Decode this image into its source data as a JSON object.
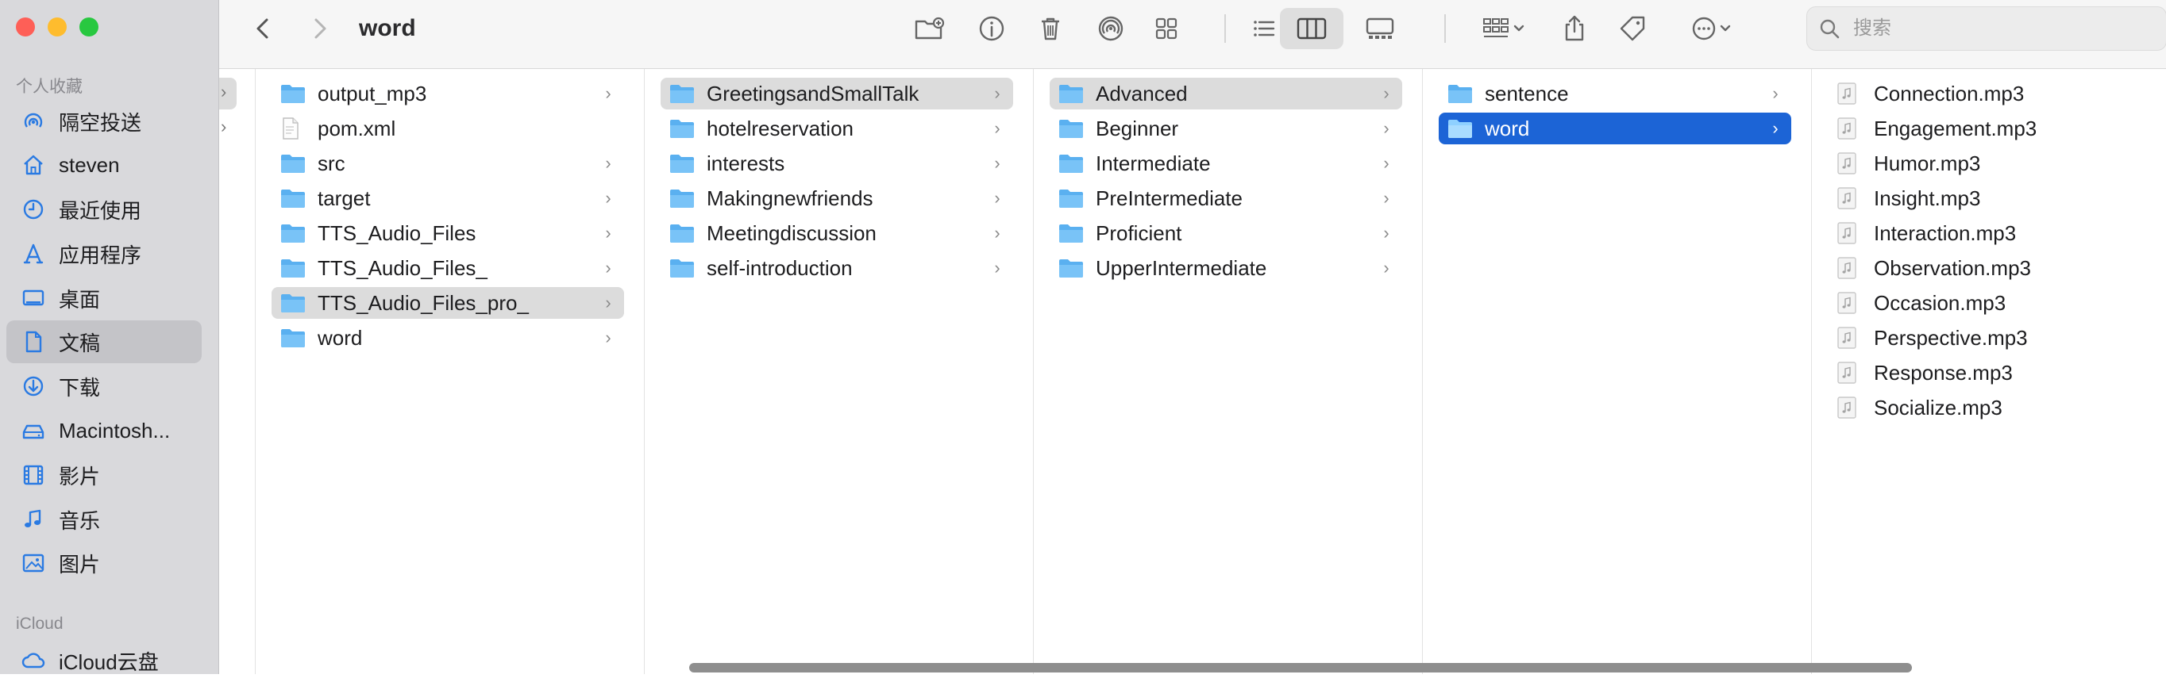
{
  "window": {
    "title": "word"
  },
  "sidebar": {
    "favorites_header": "个人收藏",
    "items": [
      {
        "label": "隔空投送",
        "icon": "airdrop-icon"
      },
      {
        "label": "steven",
        "icon": "home-icon"
      },
      {
        "label": "最近使用",
        "icon": "clock-icon"
      },
      {
        "label": "应用程序",
        "icon": "applications-icon"
      },
      {
        "label": "桌面",
        "icon": "desktop-icon"
      },
      {
        "label": "文稿",
        "icon": "document-icon",
        "selected": true
      },
      {
        "label": "下载",
        "icon": "download-icon"
      },
      {
        "label": "Macintosh...",
        "icon": "disk-icon"
      },
      {
        "label": "影片",
        "icon": "film-icon"
      },
      {
        "label": "音乐",
        "icon": "music-icon"
      },
      {
        "label": "图片",
        "icon": "photo-icon"
      }
    ],
    "icloud_header": "iCloud",
    "icloud_items": [
      {
        "label": "iCloud云盘",
        "icon": "cloud-icon"
      }
    ]
  },
  "toolbar": {
    "search_placeholder": "搜索",
    "active_view": "columns"
  },
  "columns": [
    {
      "items": [
        {
          "label": "output_mp3",
          "type": "folder",
          "has_children": true
        },
        {
          "label": "pom.xml",
          "type": "file",
          "has_children": false
        },
        {
          "label": "src",
          "type": "folder",
          "has_children": true
        },
        {
          "label": "target",
          "type": "folder",
          "has_children": true
        },
        {
          "label": "TTS_Audio_Files",
          "type": "folder",
          "has_children": true
        },
        {
          "label": "TTS_Audio_Files_",
          "type": "folder",
          "has_children": true
        },
        {
          "label": "TTS_Audio_Files_pro_",
          "type": "folder",
          "has_children": true,
          "selected": "path"
        },
        {
          "label": "word",
          "type": "folder",
          "has_children": true
        }
      ]
    },
    {
      "items": [
        {
          "label": "GreetingsandSmallTalk",
          "type": "folder",
          "has_children": true,
          "selected": "path"
        },
        {
          "label": "hotelreservation",
          "type": "folder",
          "has_children": true
        },
        {
          "label": "interests",
          "type": "folder",
          "has_children": true
        },
        {
          "label": "Makingnewfriends",
          "type": "folder",
          "has_children": true
        },
        {
          "label": "Meetingdiscussion",
          "type": "folder",
          "has_children": true
        },
        {
          "label": "self-introduction",
          "type": "folder",
          "has_children": true
        }
      ]
    },
    {
      "items": [
        {
          "label": "Advanced",
          "type": "folder",
          "has_children": true,
          "selected": "path"
        },
        {
          "label": "Beginner",
          "type": "folder",
          "has_children": true
        },
        {
          "label": "Intermediate",
          "type": "folder",
          "has_children": true
        },
        {
          "label": "PreIntermediate",
          "type": "folder",
          "has_children": true
        },
        {
          "label": "Proficient",
          "type": "folder",
          "has_children": true
        },
        {
          "label": "UpperIntermediate",
          "type": "folder",
          "has_children": true
        }
      ]
    },
    {
      "items": [
        {
          "label": "sentence",
          "type": "folder",
          "has_children": true
        },
        {
          "label": "word",
          "type": "folder",
          "has_children": true,
          "selected": "active"
        }
      ]
    },
    {
      "items": [
        {
          "label": "Connection.mp3",
          "type": "audio",
          "has_children": false
        },
        {
          "label": "Engagement.mp3",
          "type": "audio",
          "has_children": false
        },
        {
          "label": "Humor.mp3",
          "type": "audio",
          "has_children": false
        },
        {
          "label": "Insight.mp3",
          "type": "audio",
          "has_children": false
        },
        {
          "label": "Interaction.mp3",
          "type": "audio",
          "has_children": false
        },
        {
          "label": "Observation.mp3",
          "type": "audio",
          "has_children": false
        },
        {
          "label": "Occasion.mp3",
          "type": "audio",
          "has_children": false
        },
        {
          "label": "Perspective.mp3",
          "type": "audio",
          "has_children": false
        },
        {
          "label": "Response.mp3",
          "type": "audio",
          "has_children": false
        },
        {
          "label": "Socialize.mp3",
          "type": "audio",
          "has_children": false
        }
      ]
    }
  ],
  "colors": {
    "sidebar_bg": "#d9d9dc",
    "selection_blue": "#1c64d6",
    "selection_gray": "#dcdcdc",
    "folder_blue": "#5ab0f0",
    "accent_icon": "#2a7ae2"
  }
}
